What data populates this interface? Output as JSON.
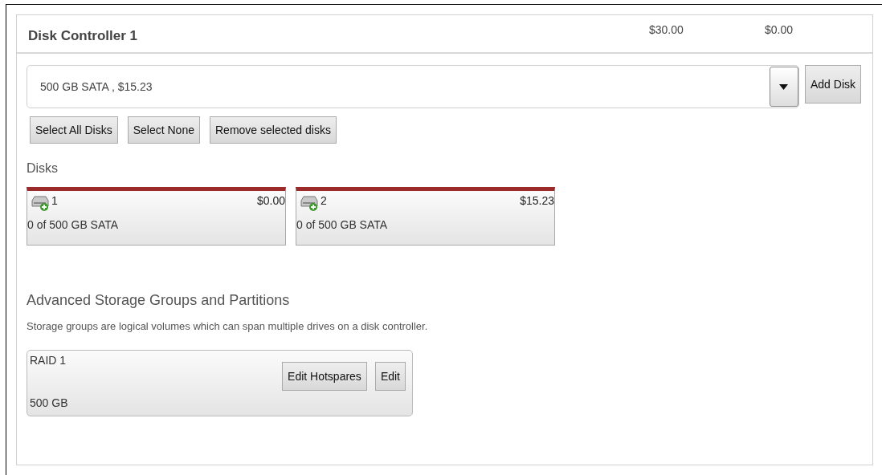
{
  "controller": {
    "title": "Disk Controller 1",
    "price_1": "$30.00",
    "price_2": "$0.00"
  },
  "disk_select": {
    "value": "500 GB SATA , $15.23",
    "button": "Add Disk"
  },
  "selection_buttons": [
    "Select All Disks",
    "Select None",
    "Remove selected disks"
  ],
  "disks_heading": "Disks",
  "disks": [
    {
      "number": "1",
      "price": "$0.00",
      "capacity": "0 of 500 GB SATA"
    },
    {
      "number": "2",
      "price": "$15.23",
      "capacity": "0 of 500 GB SATA"
    }
  ],
  "storage_groups": {
    "heading": "Advanced Storage Groups and Partitions",
    "description": "Storage groups are logical volumes which can span multiple drives on a disk controller.",
    "groups": [
      {
        "name": "RAID 1",
        "size": "500 GB",
        "buttons": [
          "Edit Hotspares",
          "Edit"
        ]
      }
    ]
  }
}
